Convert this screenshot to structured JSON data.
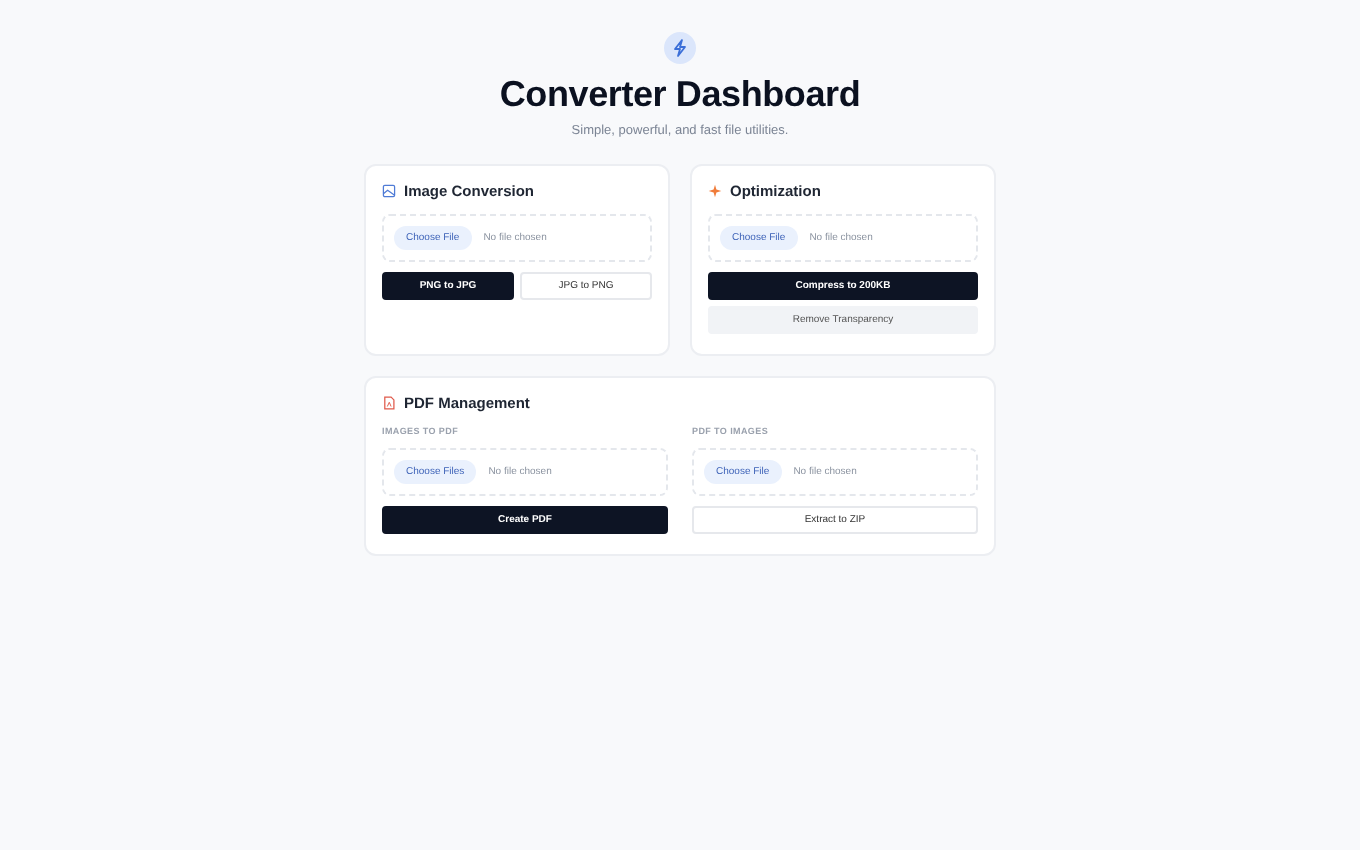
{
  "header": {
    "title": "Converter Dashboard",
    "subtitle": "Simple, powerful, and fast file utilities."
  },
  "cards": [
    {
      "title": "Image Conversion",
      "sections": [
        {
          "picker": {
            "button": "Choose File",
            "status": "No file chosen"
          },
          "buttons": [
            {
              "label": "PNG to JPG",
              "kind": "primary"
            },
            {
              "label": "JPG to PNG",
              "kind": "outline"
            }
          ]
        }
      ]
    },
    {
      "title": "Optimization",
      "sections": [
        {
          "picker": {
            "button": "Choose File",
            "status": "No file chosen"
          },
          "buttons": [
            {
              "label": "Compress to 200KB",
              "kind": "primary"
            },
            {
              "label": "Remove Transparency",
              "kind": "muted"
            }
          ]
        }
      ]
    },
    {
      "title": "PDF Management",
      "sections": [
        {
          "label": "IMAGES TO PDF",
          "picker": {
            "button": "Choose Files",
            "status": "No file chosen"
          },
          "buttons": [
            {
              "label": "Create PDF",
              "kind": "primary"
            }
          ]
        },
        {
          "label": "PDF TO IMAGES",
          "picker": {
            "button": "Choose File",
            "status": "No file chosen"
          },
          "buttons": [
            {
              "label": "Extract to ZIP",
              "kind": "outline"
            }
          ]
        }
      ]
    }
  ]
}
